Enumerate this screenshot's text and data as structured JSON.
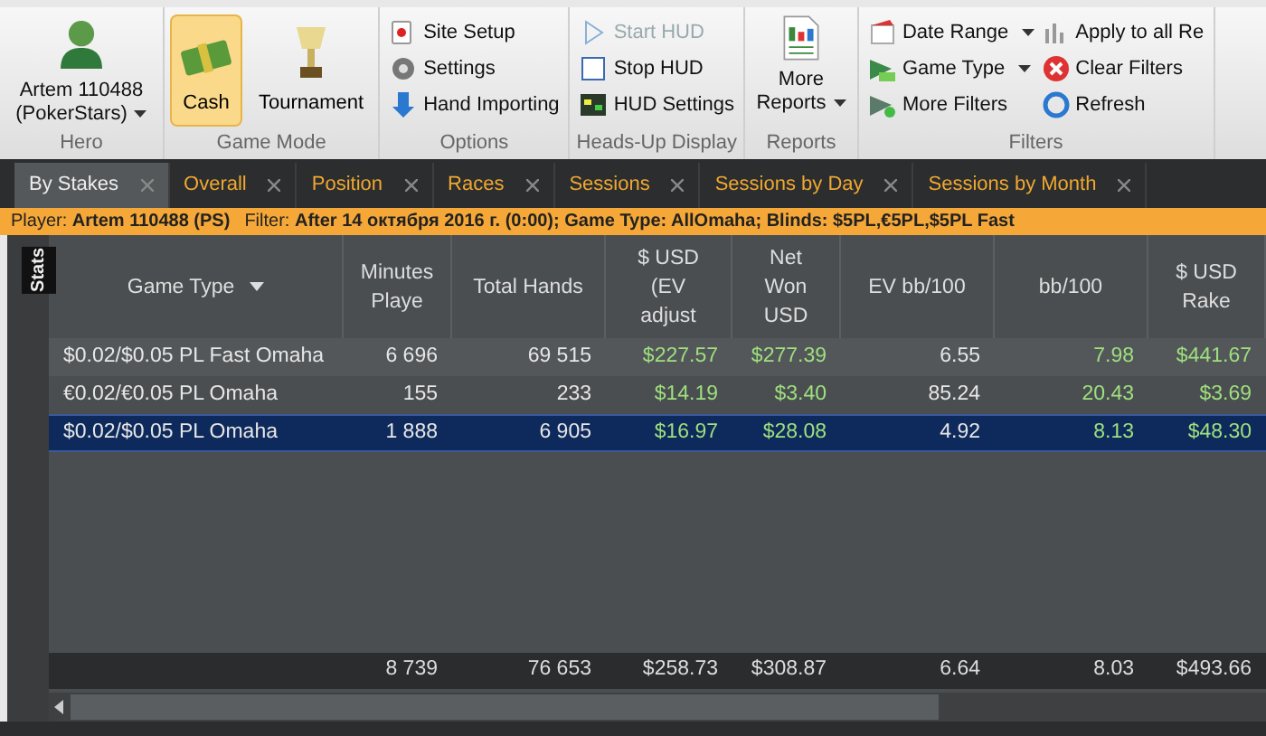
{
  "ribbon": [
    {
      "kind": "hero",
      "label": "Hero",
      "button": "Artem 110488 (PokerStars)",
      "dropdown": true
    },
    {
      "kind": "toggles",
      "label": "Game Mode",
      "items": [
        {
          "label": "Cash",
          "selected": true
        },
        {
          "label": "Tournament",
          "selected": false
        }
      ]
    },
    {
      "kind": "list",
      "label": "Options",
      "items": [
        {
          "label": "Site Setup",
          "disabled": false,
          "dropdown": false
        },
        {
          "label": "Settings",
          "disabled": false,
          "dropdown": false
        },
        {
          "label": "Hand Importing",
          "disabled": false,
          "dropdown": false
        }
      ]
    },
    {
      "kind": "list",
      "label": "Heads-Up Display",
      "items": [
        {
          "label": "Start HUD",
          "disabled": true,
          "dropdown": false
        },
        {
          "label": "Stop HUD",
          "disabled": false,
          "dropdown": false
        },
        {
          "label": "HUD Settings",
          "disabled": false,
          "dropdown": false
        }
      ]
    },
    {
      "kind": "big",
      "label": "Reports",
      "button": "More Reports",
      "dropdown": true
    },
    {
      "kind": "grid",
      "label": "Filters",
      "items": [
        {
          "label": "Date Range",
          "disabled": false,
          "dropdown": true
        },
        {
          "label": "Game Type",
          "disabled": false,
          "dropdown": true
        },
        {
          "label": "More Filters",
          "disabled": false,
          "dropdown": false
        },
        {
          "label": "Apply to all Re",
          "disabled": false,
          "dropdown": false
        },
        {
          "label": "Clear Filters",
          "disabled": false,
          "dropdown": false
        },
        {
          "label": "Refresh",
          "disabled": false,
          "dropdown": false
        }
      ]
    }
  ],
  "tabs": [
    {
      "label": "By Stakes",
      "selected": true
    },
    {
      "label": "Overall",
      "selected": false
    },
    {
      "label": "Position",
      "selected": false
    },
    {
      "label": "Races",
      "selected": false
    },
    {
      "label": "Sessions",
      "selected": false
    },
    {
      "label": "Sessions by Day",
      "selected": false
    },
    {
      "label": "Sessions by Month",
      "selected": false
    }
  ],
  "filter_bar": {
    "player": "Player: **Artem 110488 (PS)**",
    "filter": "Filter: **After 14 октября 2016 г. (0:00); Game Type: AllOmaha; Blinds: $5PL,€5PL,$5PL Fast**"
  },
  "side_tab": "Stats",
  "table": {
    "columns": [
      {
        "label": "Game Type",
        "menu": true,
        "color": "#e6e6e6"
      },
      {
        "label": "Minutes Playe",
        "menu": false,
        "color": "#e6e6e6"
      },
      {
        "label": "Total Hands",
        "menu": false,
        "color": "#e6e6e6"
      },
      {
        "label": "$ USD (EV adjust",
        "menu": false,
        "color": "#9ee07e"
      },
      {
        "label": "Net Won USD",
        "menu": false,
        "color": "#9ee07e"
      },
      {
        "label": "EV bb/100",
        "menu": false,
        "color": "#e6e6e6"
      },
      {
        "label": "bb/100",
        "menu": false,
        "color": "#9ee07e"
      },
      {
        "label": "$ USD Rake",
        "menu": false,
        "color": "#9ee07e"
      }
    ],
    "rows": [
      {
        "selected": false,
        "cells": [
          "$0.02/$0.05 PL Fast Omaha",
          "6 696",
          "69 515",
          "$227.57",
          "$277.39",
          "6.55",
          "7.98",
          "$441.67"
        ]
      },
      {
        "selected": false,
        "cells": [
          "€0.02/€0.05 PL Omaha",
          "155",
          "233",
          "$14.19",
          "$3.40",
          "85.24",
          "20.43",
          "$3.69"
        ]
      },
      {
        "selected": true,
        "cells": [
          "$0.02/$0.05 PL Omaha",
          "1 888",
          "6 905",
          "$16.97",
          "$28.08",
          "4.92",
          "8.13",
          "$48.30"
        ]
      }
    ],
    "totals": [
      "8 739",
      "76 653",
      "$258.73",
      "$308.87",
      "6.64",
      "8.03",
      "$493.66"
    ]
  }
}
